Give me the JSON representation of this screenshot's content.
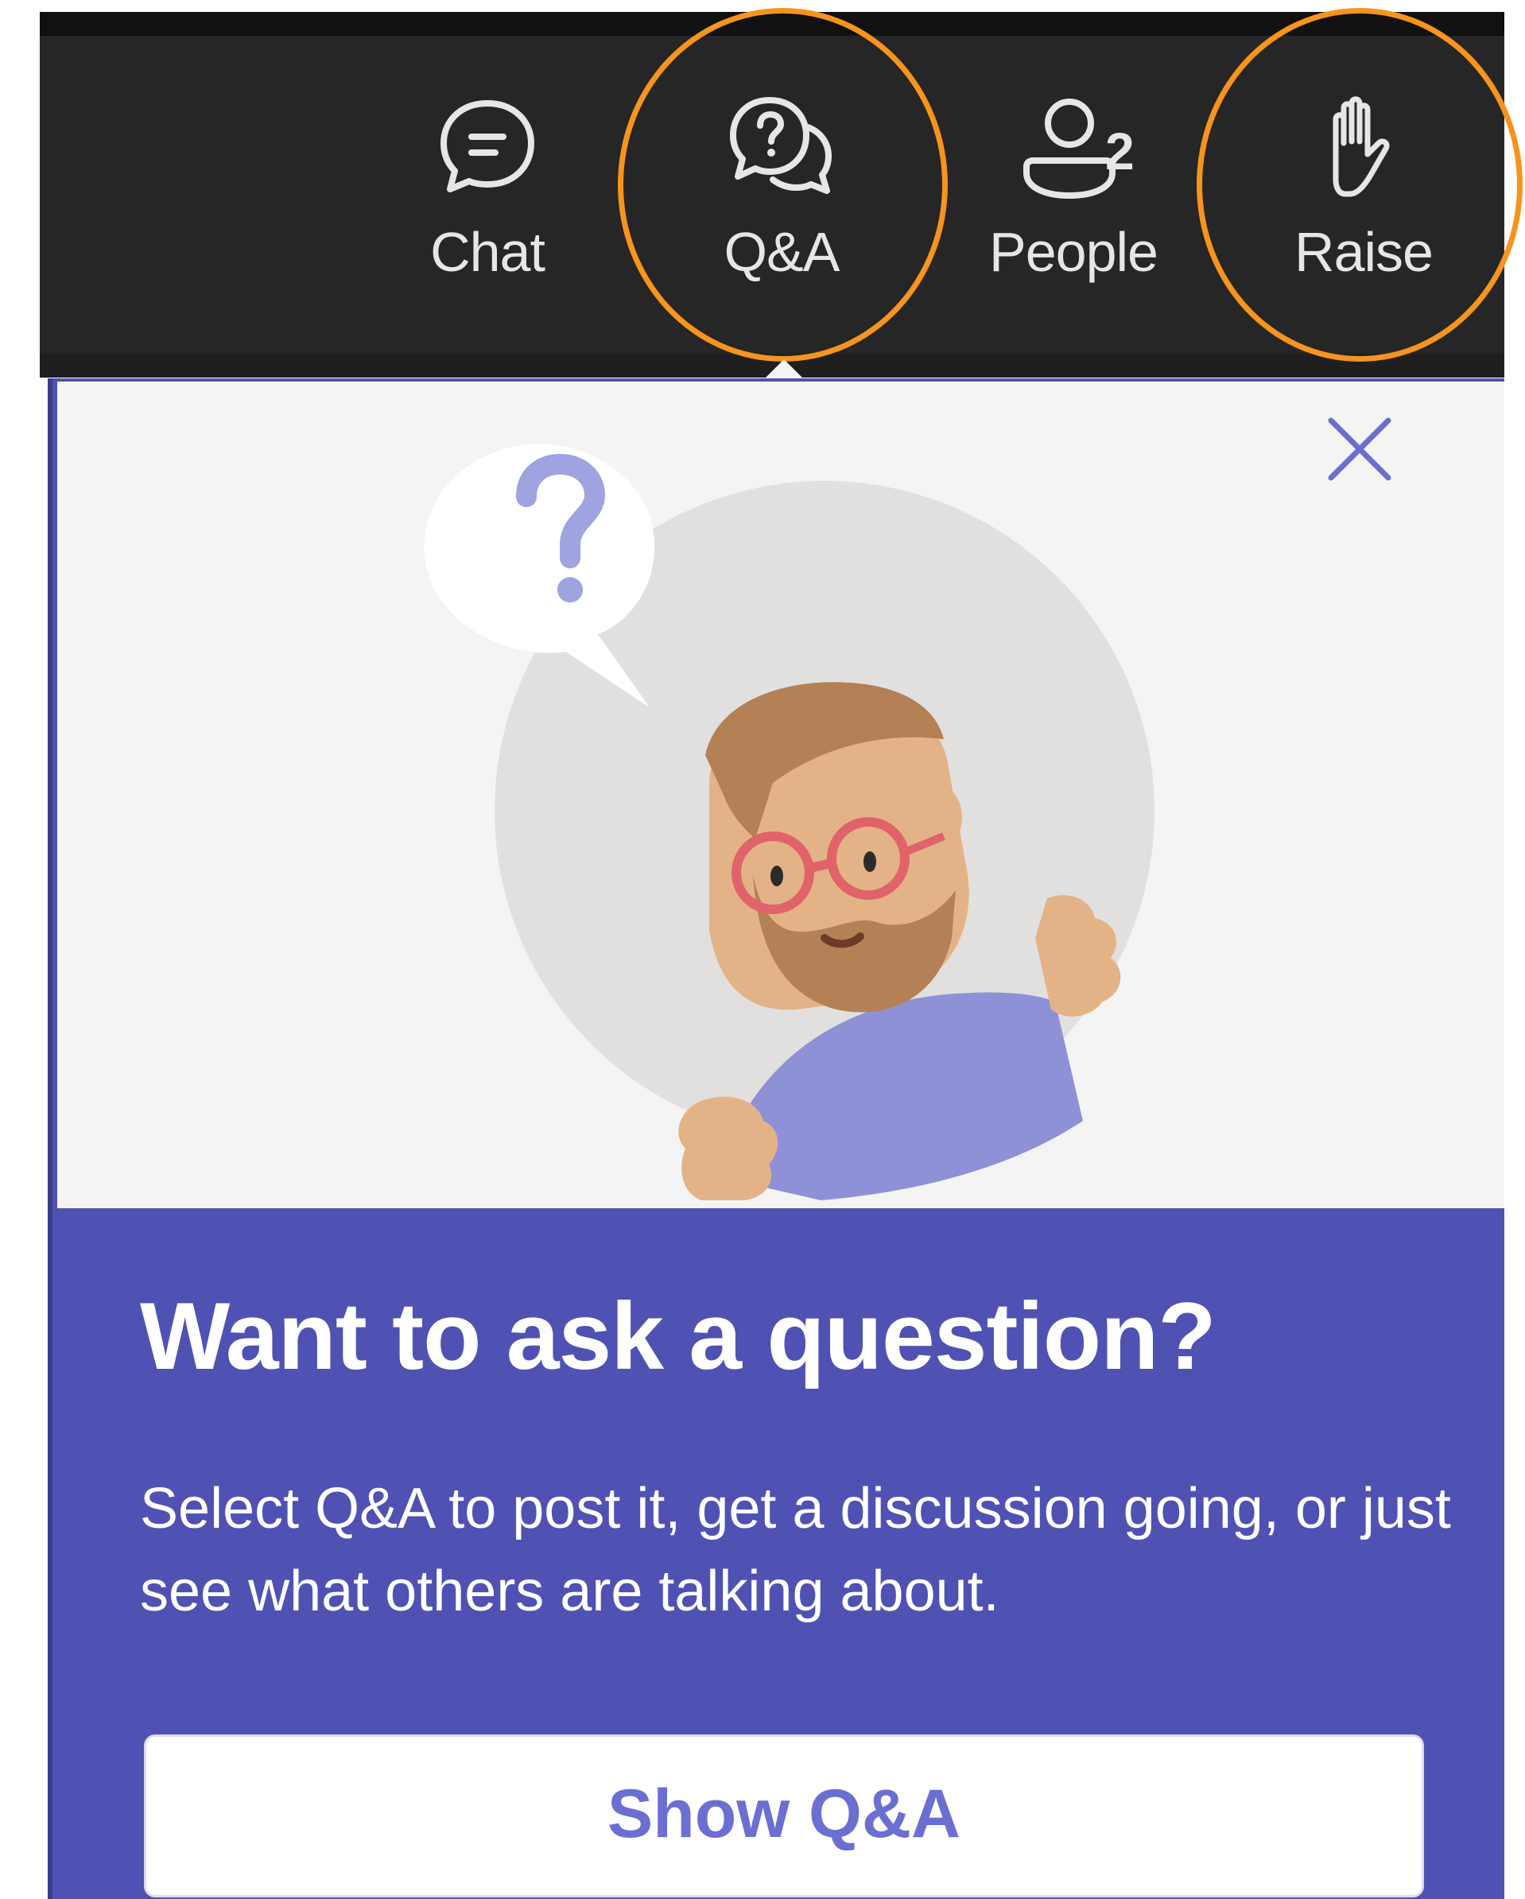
{
  "toolbar": {
    "chat_label": "Chat",
    "qa_label": "Q&A",
    "people_label": "People",
    "people_count": "2",
    "raise_label": "Raise"
  },
  "popover": {
    "title": "Want to ask a question?",
    "description": "Select Q&A to post it, get a discussion going, or just see what others are talking about.",
    "button_label": "Show Q&A",
    "illustration": "person-with-question-bubble"
  },
  "colors": {
    "toolbar_bg": "#262626",
    "card_bg": "#4f52b2",
    "highlight": "#f7941d",
    "button_text": "#6b6fd1"
  },
  "icons": {
    "chat": "chat-icon",
    "qa": "qa-icon",
    "people": "people-icon",
    "raise": "raise-hand-icon",
    "close": "close-icon"
  }
}
